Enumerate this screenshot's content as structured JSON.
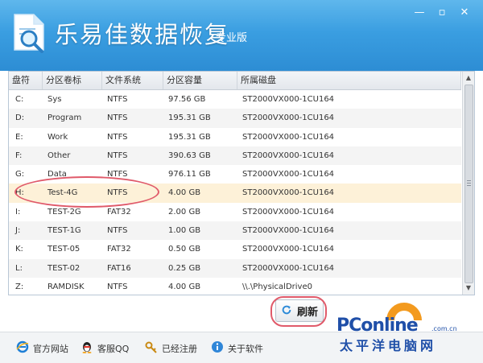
{
  "app": {
    "title": "乐易佳数据恢复",
    "edition": "专业版"
  },
  "window_controls": {
    "minimize": "—",
    "maximize": "▫",
    "close": "✕"
  },
  "table": {
    "headers": [
      "盘符",
      "分区卷标",
      "文件系统",
      "分区容量",
      "所属磁盘"
    ],
    "rows": [
      {
        "drive": "C:",
        "label": "Sys",
        "fs": "NTFS",
        "size": "97.56 GB",
        "disk": "ST2000VX000-1CU164"
      },
      {
        "drive": "D:",
        "label": "Program",
        "fs": "NTFS",
        "size": "195.31 GB",
        "disk": "ST2000VX000-1CU164"
      },
      {
        "drive": "E:",
        "label": "Work",
        "fs": "NTFS",
        "size": "195.31 GB",
        "disk": "ST2000VX000-1CU164"
      },
      {
        "drive": "F:",
        "label": "Other",
        "fs": "NTFS",
        "size": "390.63 GB",
        "disk": "ST2000VX000-1CU164"
      },
      {
        "drive": "G:",
        "label": "Data",
        "fs": "NTFS",
        "size": "976.11 GB",
        "disk": "ST2000VX000-1CU164"
      },
      {
        "drive": "H:",
        "label": "Test-4G",
        "fs": "NTFS",
        "size": "4.00 GB",
        "disk": "ST2000VX000-1CU164"
      },
      {
        "drive": "I:",
        "label": "TEST-2G",
        "fs": "FAT32",
        "size": "2.00 GB",
        "disk": "ST2000VX000-1CU164"
      },
      {
        "drive": "J:",
        "label": "TEST-1G",
        "fs": "NTFS",
        "size": "1.00 GB",
        "disk": "ST2000VX000-1CU164"
      },
      {
        "drive": "K:",
        "label": "TEST-05",
        "fs": "FAT32",
        "size": "0.50 GB",
        "disk": "ST2000VX000-1CU164"
      },
      {
        "drive": "L:",
        "label": "TEST-02",
        "fs": "FAT16",
        "size": "0.25 GB",
        "disk": "ST2000VX000-1CU164"
      },
      {
        "drive": "Z:",
        "label": "RAMDISK",
        "fs": "NTFS",
        "size": "4.00 GB",
        "disk": "\\\\.\\PhysicalDrive0"
      }
    ]
  },
  "refresh_button": {
    "label": "刷新"
  },
  "footer": {
    "website": "官方网站",
    "qq": "客服QQ",
    "registered": "已经注册",
    "about": "关于软件"
  },
  "watermark": {
    "main": "PConline",
    "domain": ".com.cn",
    "cn": "太平洋电脑网"
  },
  "colors": {
    "title_bar": "#3a9ee1",
    "selected_row": "#fdf1d8",
    "annotation": "#e05a6a",
    "watermark": "#1f4fa8"
  }
}
